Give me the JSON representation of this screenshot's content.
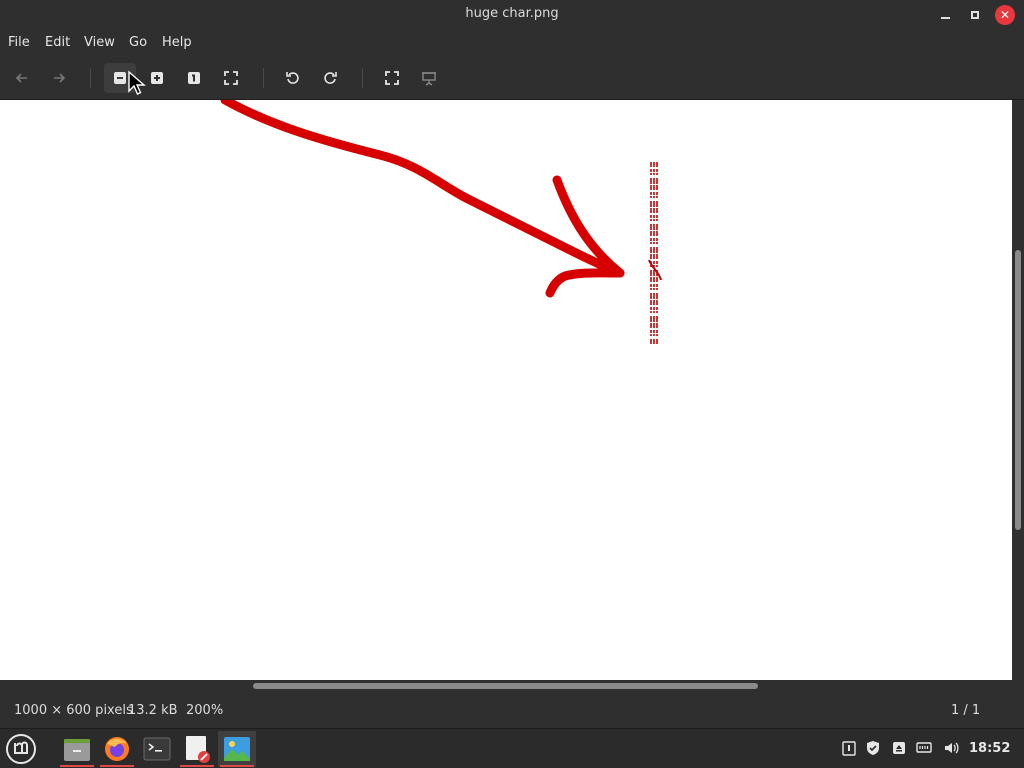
{
  "window": {
    "title": "huge char.png"
  },
  "menu": {
    "file": "File",
    "edit": "Edit",
    "view": "View",
    "go": "Go",
    "help": "Help"
  },
  "toolbar": {
    "icons": [
      "back-arrow-icon",
      "forward-arrow-icon",
      "zoom-out-icon",
      "zoom-in-icon",
      "normal-size-icon",
      "best-fit-icon",
      "rotate-left-icon",
      "rotate-right-icon",
      "fullscreen-icon",
      "slideshow-icon"
    ]
  },
  "status": {
    "dimensions": "1000 × 600 pixels",
    "filesize": "13.2 kB",
    "zoom": "200%",
    "position": "1 / 1"
  },
  "taskbar": {
    "clock": "18:52",
    "apps": [
      "mint-menu-icon",
      "file-manager-icon",
      "firefox-icon",
      "terminal-icon",
      "text-editor-icon",
      "image-viewer-icon"
    ],
    "tray": [
      "clipboard-icon",
      "shield-icon",
      "eject-icon",
      "network-icon",
      "volume-icon"
    ]
  },
  "colors": {
    "ink": "#cc0000",
    "close": "#e8383d",
    "running_indicator": "#e04848"
  }
}
